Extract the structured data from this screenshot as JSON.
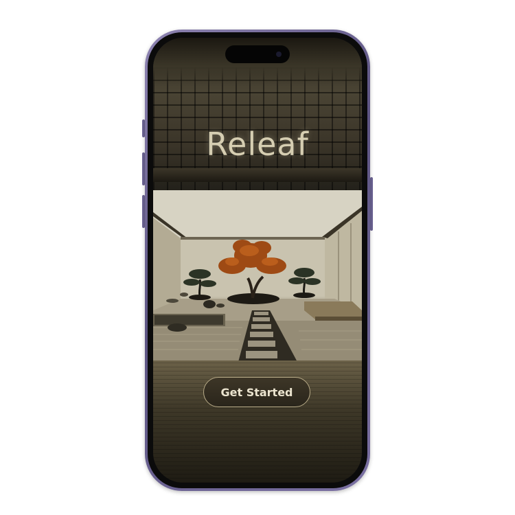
{
  "app": {
    "title": "Releaf",
    "cta_label": "Get Started"
  },
  "icons": {
    "hero": "zen-garden-bonsai-illustration"
  },
  "colors": {
    "title_text": "#d6ceb2",
    "cta_border": "#b8ab88",
    "cta_text": "#ebe4cf",
    "frame": "#7a70a2"
  }
}
